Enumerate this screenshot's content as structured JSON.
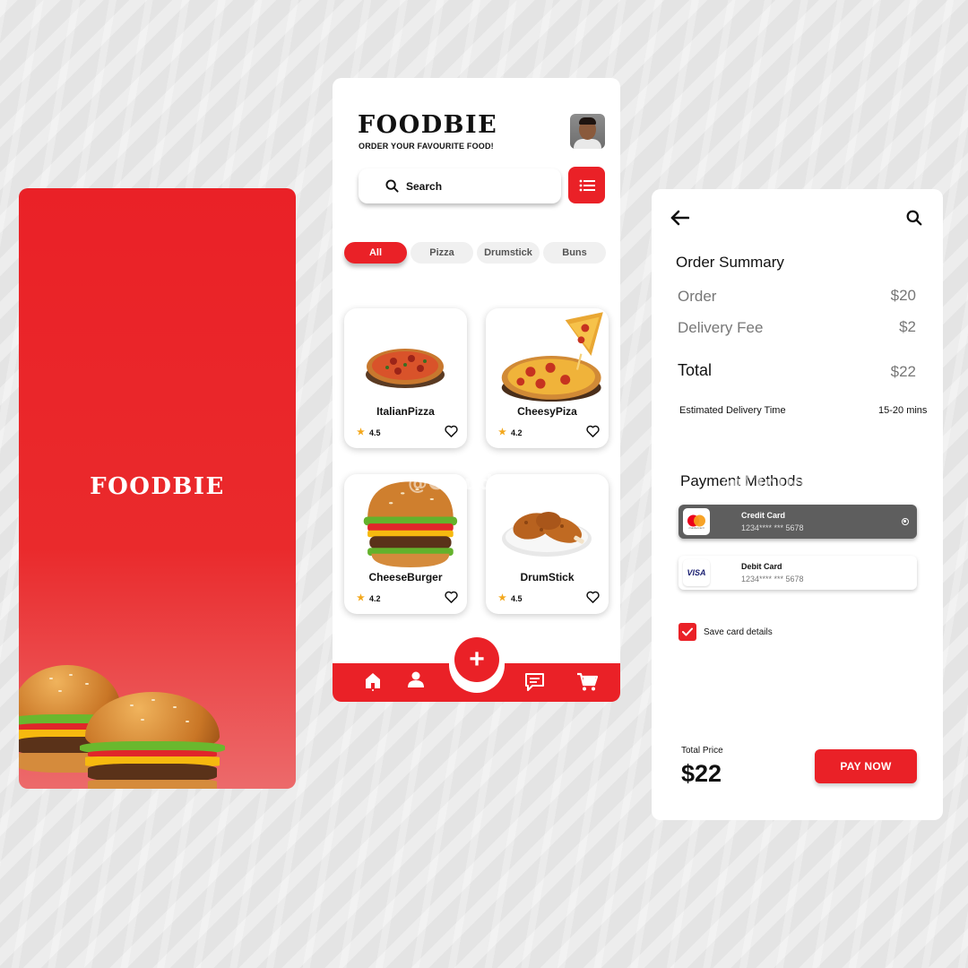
{
  "brand": "FOODBIE",
  "watermark": "@CloudGrafix",
  "home": {
    "brand": "FOODBIE",
    "tagline": "ORDER YOUR FAVOURITE FOOD!",
    "search_label": "Search",
    "categories": [
      "All",
      "Pizza",
      "Drumstick",
      "Buns"
    ],
    "active_category": "All",
    "foods": [
      {
        "name": "ItalianPizza",
        "rating": "4.5"
      },
      {
        "name": "CheesyPiza",
        "rating": "4.2"
      },
      {
        "name": "CheeseBurger",
        "rating": "4.2"
      },
      {
        "name": "DrumStick",
        "rating": "4.5"
      }
    ],
    "fab_symbol": "+",
    "nav_icons": [
      "home-icon",
      "user-icon",
      "chat-icon",
      "cart-icon"
    ]
  },
  "order": {
    "title": "Order Summary",
    "rows": [
      {
        "label": "Order",
        "value": "$20"
      },
      {
        "label": "Delivery Fee",
        "value": "$2"
      }
    ],
    "total_label": "Total",
    "total_value": "$22",
    "eta_label": "Estimated Delivery Time",
    "eta_value": "15-20 mins",
    "payment_title": "Payment Methods",
    "payment_methods": [
      {
        "title": "Credit Card",
        "number": "1234**** *** 5678",
        "brand": "mastercard"
      },
      {
        "title": "Debit Card",
        "number": "1234**** *** 5678",
        "brand": "VISA"
      }
    ],
    "save_card_label": "Save card details",
    "save_card_checked": true,
    "total_price_label": "Total Price",
    "total_price_value": "$22",
    "pay_button": "PAY NOW"
  },
  "colors": {
    "accent": "#ea2127",
    "selected_card": "#5e5e5e",
    "star": "#f3a71a"
  }
}
